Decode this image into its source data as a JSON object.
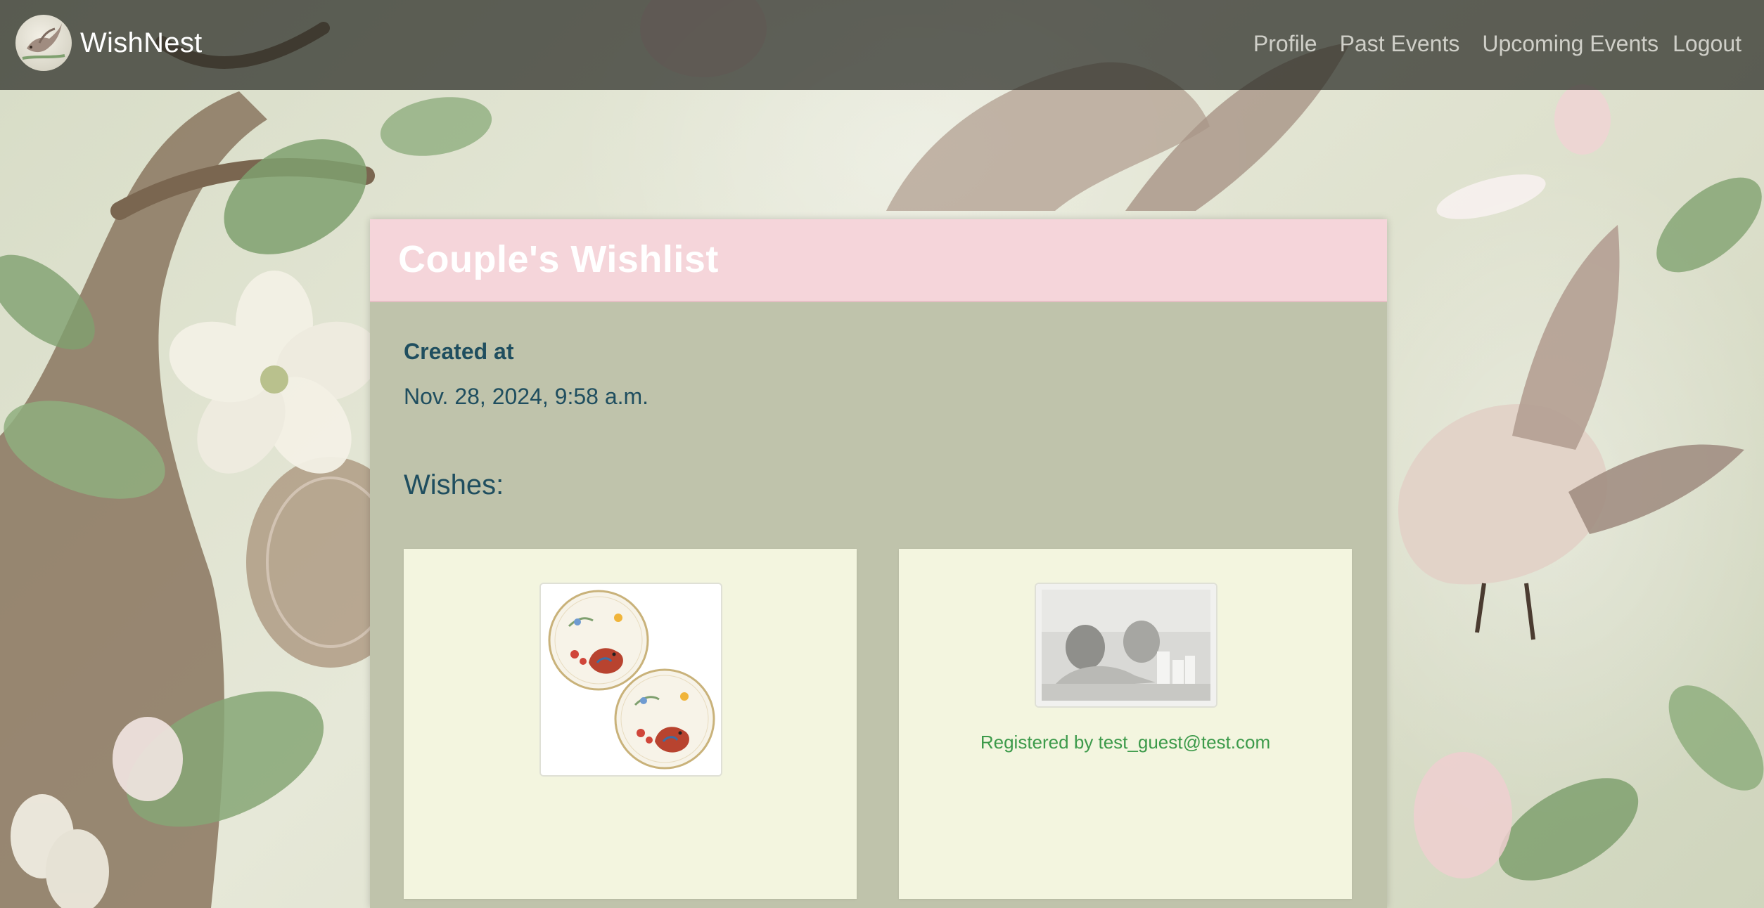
{
  "navbar": {
    "brand": "WishNest",
    "logo_icon": "bird-logo-icon",
    "links": {
      "profile": "Profile",
      "past_events": "Past Events",
      "upcoming_events": "Upcoming Events",
      "logout": "Logout"
    }
  },
  "wishlist": {
    "title": "Couple's Wishlist",
    "created_label": "Created at",
    "created_value": "Nov. 28, 2024, 9:58 a.m.",
    "wishes_heading": "Wishes:",
    "wishes": [
      {
        "image": "decorative-plates-image",
        "registered_text": ""
      },
      {
        "image": "couple-spa-photo-image",
        "registered_text": "Registered by test_guest@test.com"
      }
    ]
  },
  "colors": {
    "navbar_bg": "#2a2c24",
    "header_pink": "#f5d5da",
    "card_bg": "#bfc3ab",
    "wish_bg": "#f3f5df",
    "text_teal": "#1f4e5f",
    "registered_green": "#3c9a4a"
  }
}
